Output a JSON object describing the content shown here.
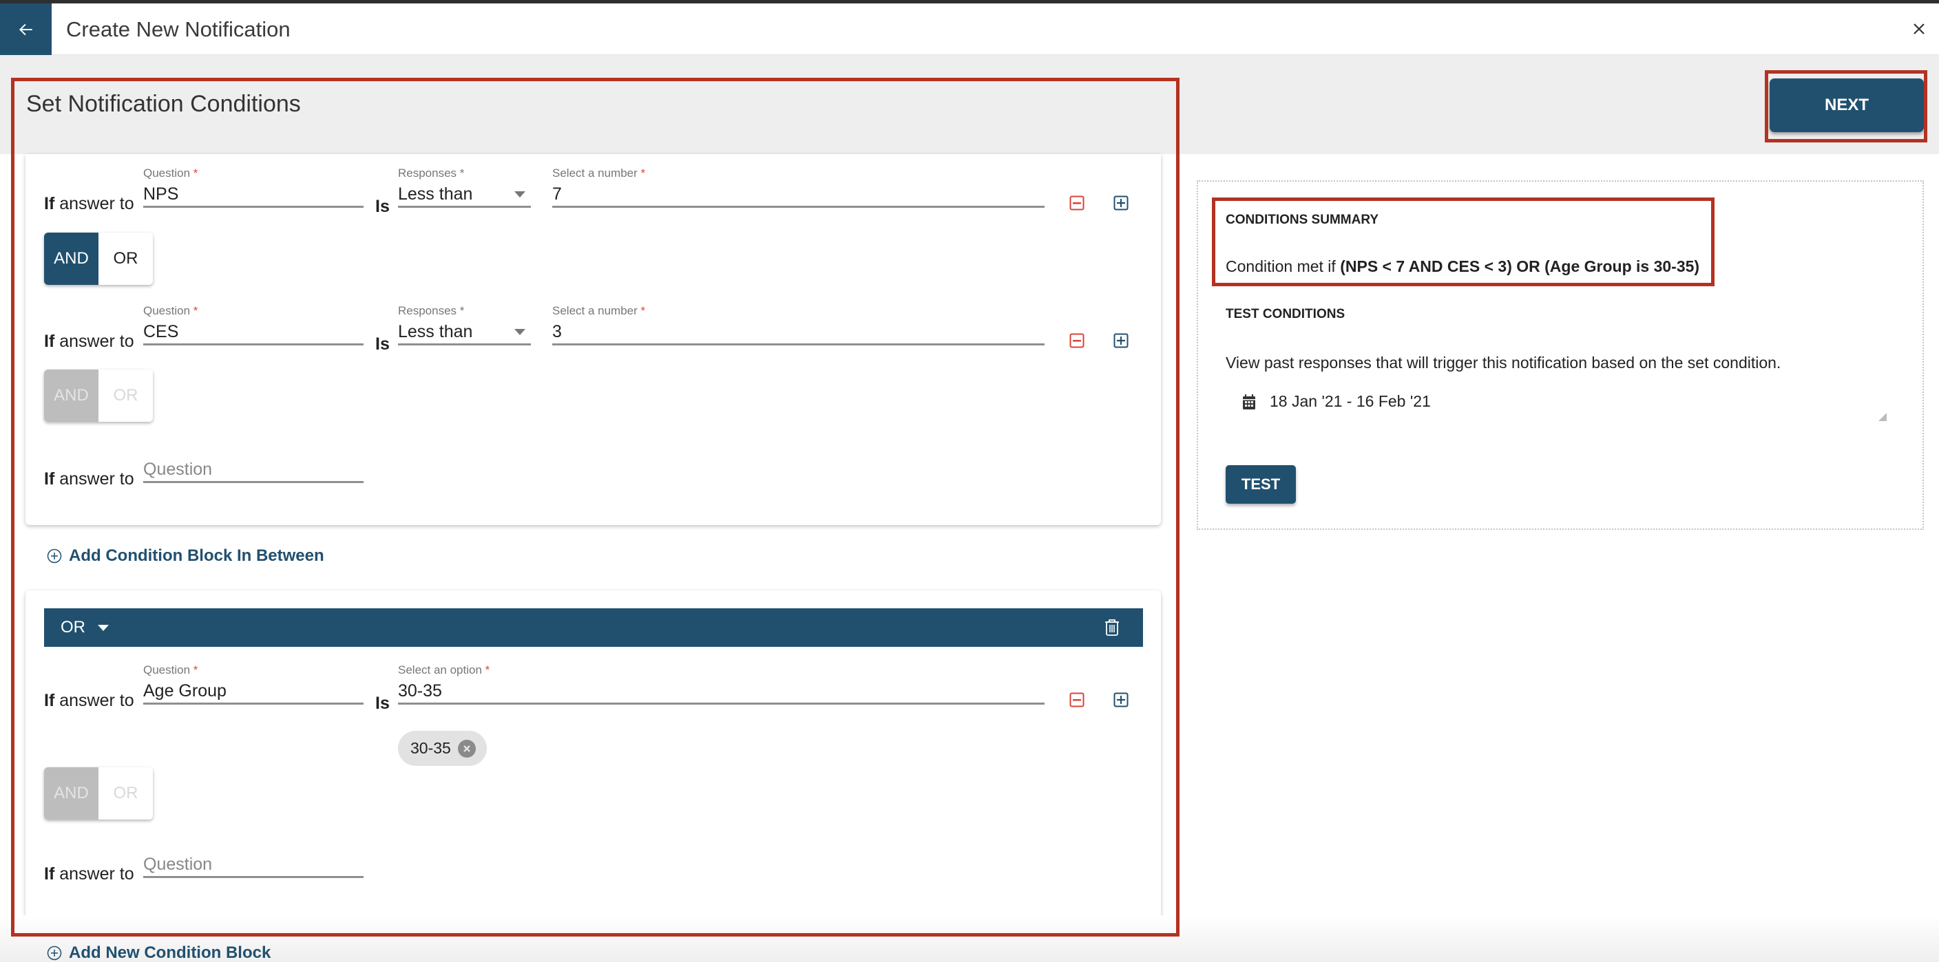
{
  "window": {
    "title": "Create New Notification",
    "back_icon": "arrow-left-icon",
    "close_icon": "close-icon"
  },
  "page": {
    "section_title": "Set Notification Conditions",
    "next_label": "NEXT"
  },
  "blocks": [
    {
      "rows": [
        {
          "if_bold": "If",
          "if_text": " answer to",
          "question_label": "Question",
          "question_value": "NPS",
          "is_label": "Is",
          "responses_label": "Responses",
          "responses_value": "Less than",
          "value_label": "Select a number",
          "value": "7",
          "required_mark": "*"
        },
        {
          "if_bold": "If",
          "if_text": " answer to",
          "question_label": "Question",
          "question_value": "CES",
          "is_label": "Is",
          "responses_label": "Responses",
          "responses_value": "Less than",
          "value_label": "Select a number",
          "value": "3",
          "required_mark": "*"
        },
        {
          "if_bold": "If",
          "if_text": " answer to",
          "question_placeholder": "Question"
        }
      ],
      "toggles": [
        {
          "and_label": "AND",
          "or_label": "OR",
          "selected": "AND",
          "enabled": true
        },
        {
          "and_label": "AND",
          "or_label": "OR",
          "selected": "AND",
          "enabled": false
        }
      ]
    },
    {
      "operator": "OR",
      "rows": [
        {
          "if_bold": "If",
          "if_text": " answer to",
          "question_label": "Question",
          "question_value": "Age Group",
          "is_label": "Is",
          "option_label": "Select an option",
          "option_value": "30-35",
          "chips": [
            "30-35"
          ],
          "required_mark": "*"
        },
        {
          "if_bold": "If",
          "if_text": " answer to",
          "question_placeholder": "Question"
        }
      ],
      "toggles": [
        {
          "and_label": "AND",
          "or_label": "OR",
          "selected": "AND",
          "enabled": false
        }
      ]
    }
  ],
  "links": {
    "add_between": "Add Condition Block In Between",
    "add_new": "Add New Condition Block"
  },
  "summary": {
    "heading": "CONDITIONS SUMMARY",
    "prefix": "Condition met if ",
    "expression": "(NPS < 7 AND CES < 3) OR (Age Group is 30-35)"
  },
  "test": {
    "heading": "TEST CONDITIONS",
    "description": "View past responses that will trigger this notification based on the set condition.",
    "date_range": "18 Jan '21 - 16 Feb '21",
    "button_label": "TEST"
  },
  "colors": {
    "primary": "#21506f",
    "highlight": "#b33222",
    "remove": "#d9443a",
    "required": "#e0453a"
  }
}
